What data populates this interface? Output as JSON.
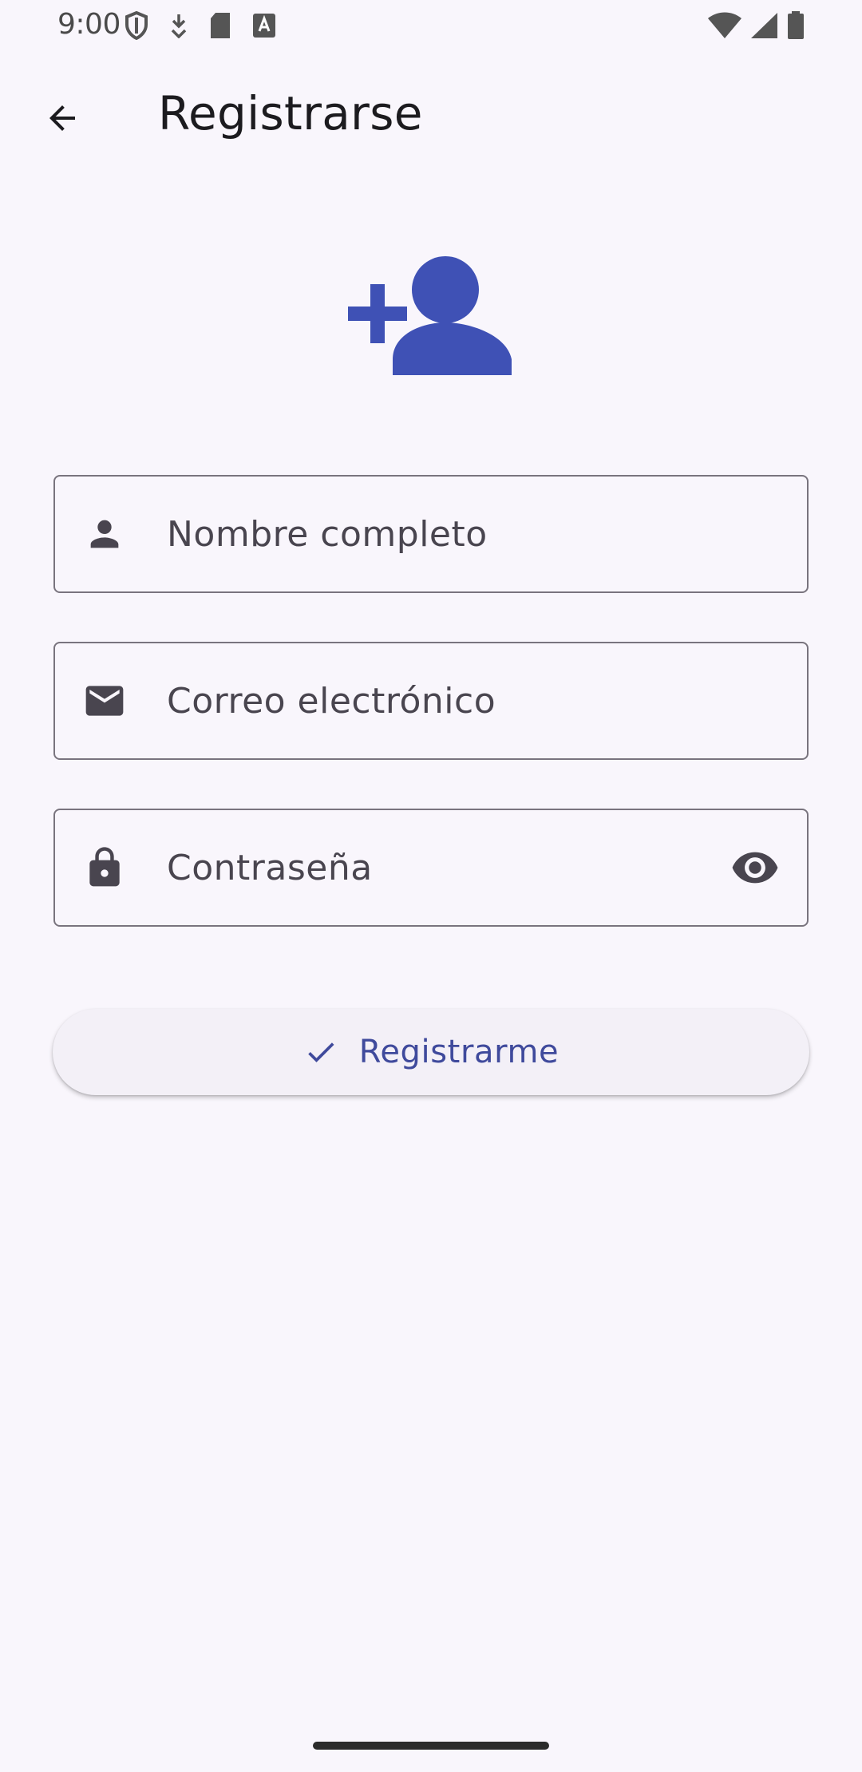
{
  "status_bar": {
    "time": "9:00",
    "left_icons": [
      "shield-icon",
      "download-icon",
      "sd-card-icon",
      "keyboard-a-icon"
    ],
    "right_icons": [
      "wifi-icon",
      "cell-signal-icon",
      "battery-icon"
    ]
  },
  "app_bar": {
    "back_icon": "arrow-back-icon",
    "title": "Registrarse"
  },
  "hero": {
    "icon": "person-add-icon",
    "color": "#3f51b5"
  },
  "form": {
    "name_field": {
      "icon": "person-icon",
      "placeholder": "Nombre completo",
      "value": ""
    },
    "email_field": {
      "icon": "mail-icon",
      "placeholder": "Correo electrónico",
      "value": ""
    },
    "password_field": {
      "icon": "lock-icon",
      "placeholder": "Contraseña",
      "value": "",
      "trailing_icon": "eye-icon"
    },
    "submit": {
      "icon": "check-icon",
      "label": "Registrarme"
    }
  },
  "colors": {
    "background": "#f9f6fc",
    "accent": "#3f51b5",
    "button_label": "#3f4a9c",
    "outline": "#79747e"
  }
}
